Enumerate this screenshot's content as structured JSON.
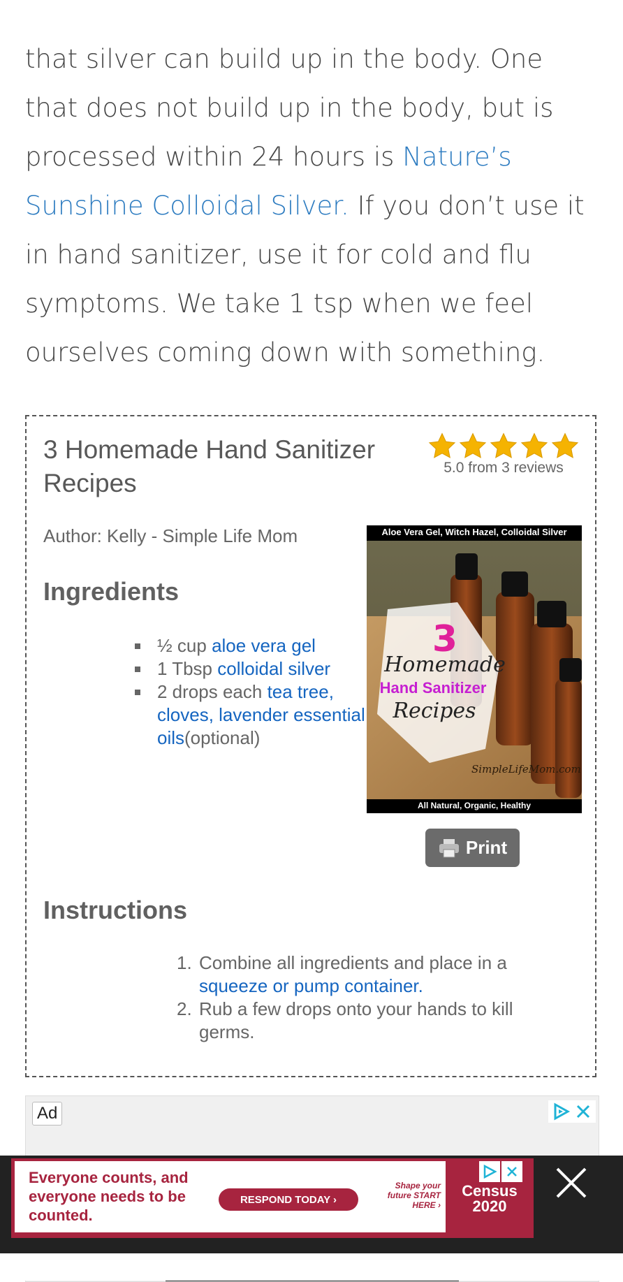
{
  "status_bar": {
    "time": "",
    "icons": ""
  },
  "article": {
    "text_1": "that silver can build up in the body. One that does not build up in the body, but is processed within 24 hours is ",
    "link": "Nature’s Sunshine Colloidal Silver.",
    "text_2": " If you don’t use it in hand sanitizer, use it for cold and flu symptoms. We take 1 tsp when we feel ourselves coming down with something."
  },
  "recipe": {
    "title": "3 Homemade Hand Sanitizer Recipes",
    "rating_text": "5.0 from 3 reviews",
    "stars": 5,
    "author": "Author: Kelly - Simple Life Mom",
    "ingredients_heading": "Ingredients",
    "ingredients": [
      {
        "prefix": "½ cup ",
        "link": "aloe vera gel",
        "suffix": ""
      },
      {
        "prefix": "1 Tbsp ",
        "link": "colloidal silver",
        "suffix": ""
      },
      {
        "prefix": "2 drops each ",
        "link": "tea tree, cloves, lavender essential oils",
        "suffix": "(optional)"
      }
    ],
    "image": {
      "top_caption": "Aloe Vera Gel, Witch Hazel, Colloidal Silver",
      "number": "3",
      "line1": "Homemade",
      "line2": "Hand Sanitizer",
      "line3": "Recipes",
      "watermark": "SimpleLifeMom.com",
      "bottom_caption": "All Natural, Organic, Healthy"
    },
    "print_label": "Print",
    "instructions_heading": "Instructions",
    "instructions": [
      {
        "num": "1.",
        "text": "Combine all ingredients and place in a ",
        "link": "squeeze or pump container."
      },
      {
        "num": "2.",
        "text": "Rub a few drops onto your hands to kill germs.",
        "link": ""
      }
    ]
  },
  "ad_frame": {
    "label": "Ad"
  },
  "bottom_ad": {
    "message": "Everyone counts, and everyone needs to be counted.",
    "button": "RESPOND TODAY ›",
    "shape": "Shape your future START HERE ›",
    "logo_top": "Census",
    "logo_year": "2020",
    "accent": "#a7243f"
  }
}
